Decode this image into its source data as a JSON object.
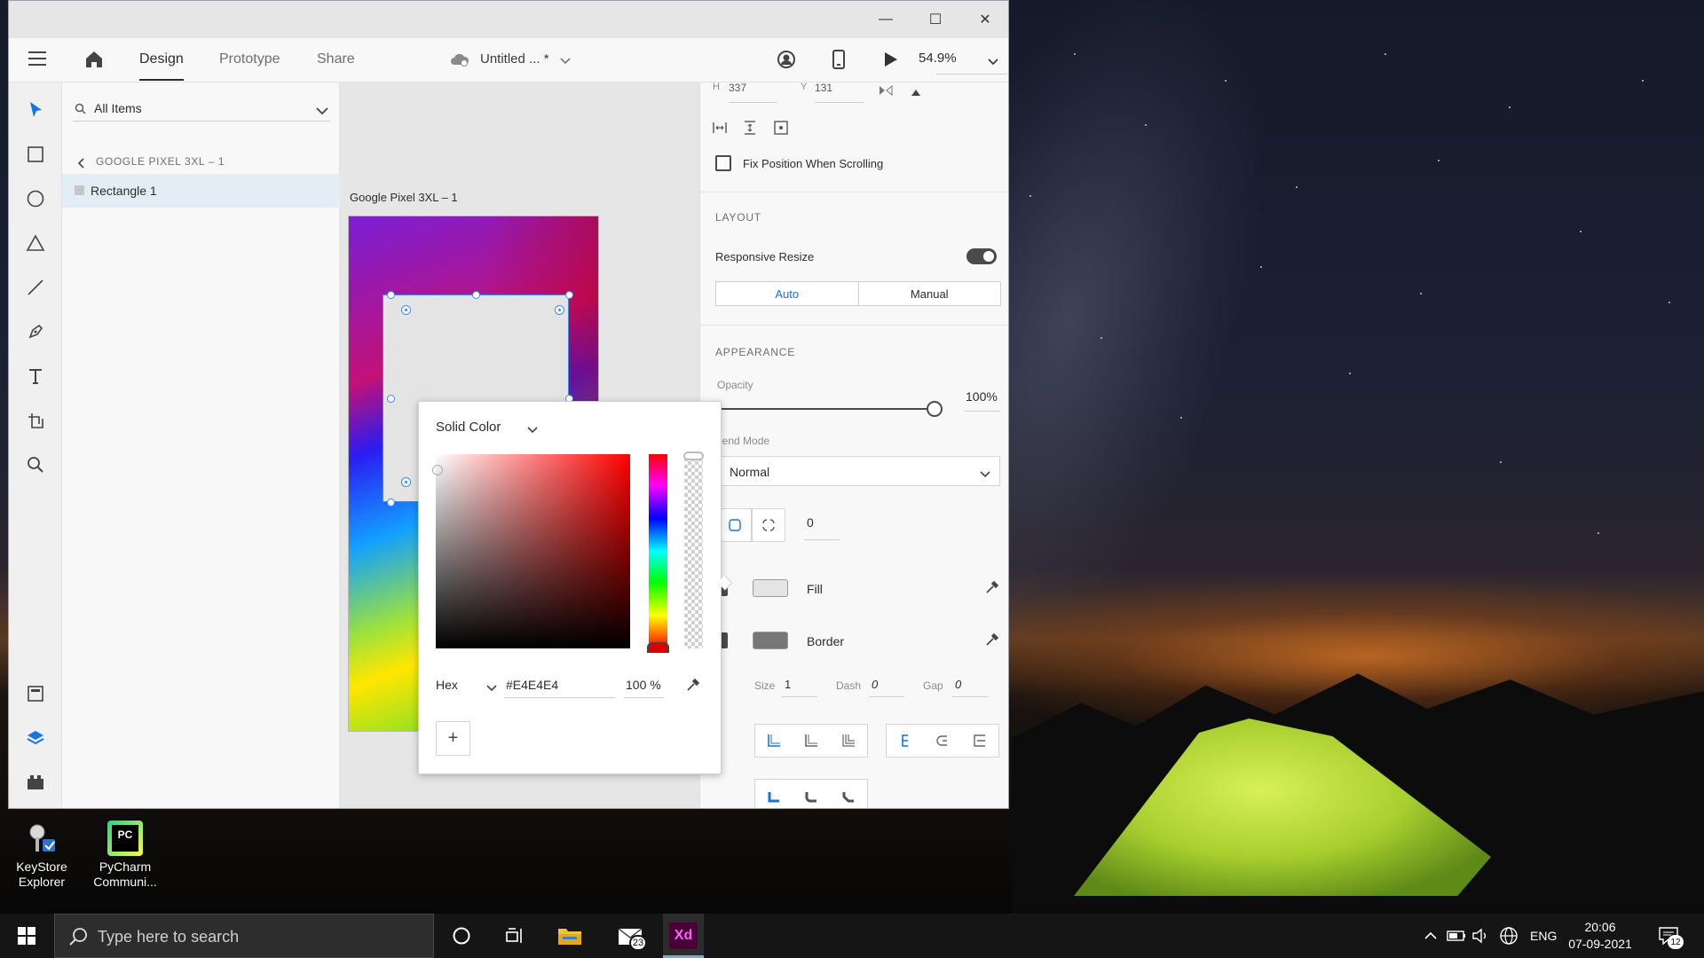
{
  "window": {
    "controls": {
      "minimize": "—",
      "maximize": "☐",
      "close": "✕"
    }
  },
  "appbar": {
    "tabs": [
      {
        "label": "Design",
        "active": true
      },
      {
        "label": "Prototype",
        "active": false
      },
      {
        "label": "Share",
        "active": false
      }
    ],
    "doc_title": "Untitled ... *",
    "zoom": "54.9%"
  },
  "layers": {
    "filter_label": "All Items",
    "breadcrumb": "GOOGLE PIXEL 3XL – 1",
    "items": [
      {
        "label": "Rectangle 1",
        "selected": true
      }
    ]
  },
  "canvas": {
    "artboard_label": "Google Pixel 3XL – 1"
  },
  "props": {
    "h_label": "H",
    "h_value": "337",
    "y_label": "Y",
    "y_value": "131",
    "fix_position_label": "Fix Position When Scrolling",
    "layout_head": "LAYOUT",
    "responsive_resize_label": "Responsive Resize",
    "responsive_resize_on": true,
    "resize_modes": [
      "Auto",
      "Manual"
    ],
    "appearance_head": "APPEARANCE",
    "opacity_label": "Opacity",
    "opacity_value": "100%",
    "blend_mode_label": "lend Mode",
    "blend_mode_value": "Normal",
    "corner_radius_value": "0",
    "fill_label": "Fill",
    "fill_color": "#E4E4E4",
    "border_label": "Border",
    "border_color": "#777777",
    "size_label": "Size",
    "size_value": "1",
    "dash_label": "Dash",
    "dash_value": "0",
    "gap_label": "Gap",
    "gap_value": "0"
  },
  "color_picker": {
    "mode": "Solid Color",
    "format": "Hex",
    "hex_value": "#E4E4E4",
    "alpha_value": "100 %",
    "add_label": "+"
  },
  "desktop": {
    "icons": [
      {
        "label_line1": "KeyStore",
        "label_line2": "Explorer",
        "icon": "keystore-icon"
      },
      {
        "label_line1": "PyCharm",
        "label_line2": "Communi...",
        "icon": "pycharm-icon",
        "badge": "PC"
      }
    ]
  },
  "taskbar": {
    "search_placeholder": "Type here to search",
    "mail_badge": "23",
    "xd_label": "Xd",
    "language": "ENG",
    "time": "20:06",
    "date": "07-09-2021",
    "notification_count": "12"
  }
}
